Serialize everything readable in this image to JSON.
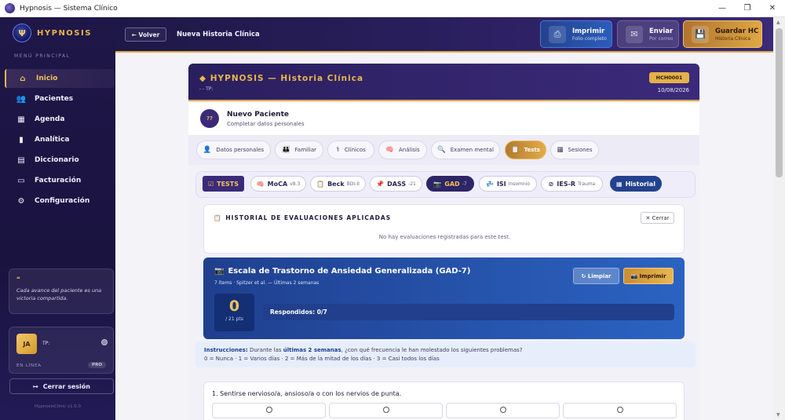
{
  "window": {
    "title": "Hypnosis — Sistema Clínico",
    "minimize": "—",
    "maximize": "❐",
    "close": "✕"
  },
  "sidebar": {
    "brand": "HYPNOSIS",
    "logo_glyph": "Ψ",
    "menu_heading": "MENÚ PRINCIPAL",
    "items": [
      {
        "label": "Inicio",
        "icon": "home-icon",
        "glyph": "⌂",
        "active": true
      },
      {
        "label": "Pacientes",
        "icon": "users-icon",
        "glyph": "👥"
      },
      {
        "label": "Agenda",
        "icon": "calendar-icon",
        "glyph": "▦"
      },
      {
        "label": "Analítica",
        "icon": "chart-icon",
        "glyph": "▮"
      },
      {
        "label": "Diccionario",
        "icon": "book-icon",
        "glyph": "▤"
      },
      {
        "label": "Facturación",
        "icon": "invoice-icon",
        "glyph": "▭"
      },
      {
        "label": "Configuración",
        "icon": "gear-icon",
        "glyph": "⚙"
      }
    ],
    "quote_mark": "❝",
    "quote": "Cada avance del paciente es una victoria compartida.",
    "user": {
      "initials": "JA",
      "tp": "TP:",
      "status": "EN LÍNEA",
      "badge": "PRO"
    },
    "logout": "Cerrar sesión",
    "logout_glyph": "↦",
    "version": "HypnosisClinic v1.0.0"
  },
  "topbar": {
    "back": "← Volver",
    "title": "Nueva Historia Clínica",
    "print": {
      "label": "Imprimir",
      "sub": "Folio completo",
      "glyph": "⎙"
    },
    "send": {
      "label": "Enviar",
      "sub": "Por correo",
      "glyph": "✉"
    },
    "save": {
      "label": "Guardar HC",
      "sub": "Historia Clínica",
      "glyph": "💾"
    }
  },
  "record": {
    "title": "◆ HYPNOSIS — Historia Clínica",
    "subtitle": "- - TP:",
    "code": "HCH0001",
    "date": "10/08/2026"
  },
  "patient": {
    "initials": "??",
    "name": "Nuevo Paciente",
    "subtitle": "Completar datos personales"
  },
  "tabs": [
    {
      "label": "Datos personales",
      "glyph": "👤"
    },
    {
      "label": "Familiar",
      "glyph": "👪"
    },
    {
      "label": "Clínicos",
      "glyph": "⚕"
    },
    {
      "label": "Análisis",
      "glyph": "🧠"
    },
    {
      "label": "Examen mental",
      "glyph": "🔍"
    },
    {
      "label": "Tests",
      "glyph": "📋",
      "active": true
    },
    {
      "label": "Sesiones",
      "glyph": "▦"
    }
  ],
  "test_tabs": [
    {
      "label": "TESTS",
      "small": "",
      "glyph": "☑"
    },
    {
      "label": "MoCA",
      "small": "v8.3",
      "glyph": "🧠"
    },
    {
      "label": "Beck",
      "small": "BDI-II",
      "glyph": "📋"
    },
    {
      "label": "DASS",
      "small": "-21",
      "glyph": "📌"
    },
    {
      "label": "GAD",
      "small": "-7",
      "glyph": "📷"
    },
    {
      "label": "ISI",
      "small": "Insomnio",
      "glyph": "💤"
    },
    {
      "label": "IES-R",
      "small": "Trauma",
      "glyph": "⊘"
    },
    {
      "label": "Historial",
      "small": "",
      "glyph": "▦"
    }
  ],
  "history": {
    "title": "HISTORIAL DE EVALUACIONES APLICADAS",
    "glyph": "📋",
    "close": "✕ Cerrar",
    "empty": "No hay evaluaciones registradas para este test."
  },
  "gad": {
    "title": "Escala de Trastorno de Ansiedad Generalizada (GAD-7)",
    "glyph": "📷",
    "subtitle": "7 ítems · Spitzer et al. — Últimas 2 semanas",
    "clear": "↻ Limpiar",
    "print": "📷 Imprimir",
    "score": "0",
    "max": "/ 21 pts",
    "answered": "Respondidos: 0/7",
    "progress": 0
  },
  "instructions": {
    "label": "Instrucciones:",
    "text_before": " Durante las ",
    "emphasis": "últimas 2 semanas",
    "text_after": ", ¿con qué frecuencia le han molestado los siguientes problemas?",
    "scale": "0 = Nunca  ·  1 = Varios días  ·  2 = Más de la mitad de los días  ·  3 = Casi todos los días"
  },
  "question": {
    "text": "1. Sentirse nervioso/a, ansioso/a o con los nervios de punta."
  }
}
